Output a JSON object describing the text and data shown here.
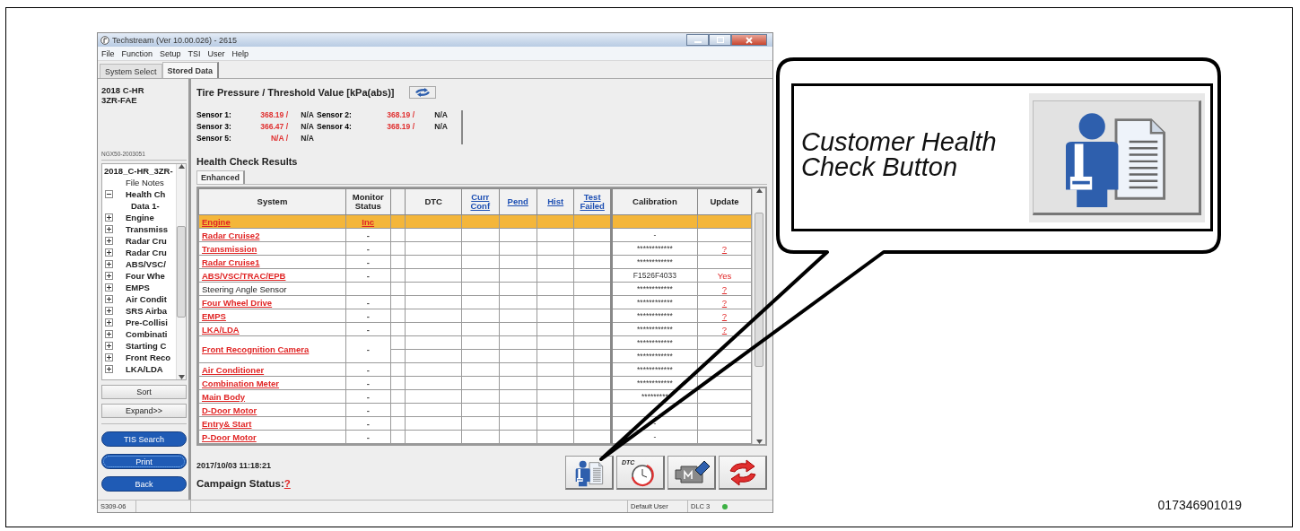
{
  "window": {
    "title": "Techstream (Ver 10.00.026) - 2615",
    "menu": [
      "File",
      "Function",
      "Setup",
      "TSI",
      "User",
      "Help"
    ],
    "tabs": [
      {
        "label": "System Select",
        "selected": false
      },
      {
        "label": "Stored Data",
        "selected": true
      }
    ],
    "vehicle": {
      "model": "2018 C-HR",
      "engine": "3ZR-FAE",
      "vin": "NGX50-2003051"
    },
    "tree": {
      "label": "2018_C-HR_3ZR-",
      "children": [
        {
          "label": "File Notes"
        },
        {
          "label": "Health Ch",
          "expanded": true,
          "children": [
            {
              "label": "Data 1-"
            }
          ]
        },
        {
          "label": "Engine",
          "expanded": false
        },
        {
          "label": "Transmiss",
          "expanded": false
        },
        {
          "label": "Radar Cru",
          "expanded": false
        },
        {
          "label": "Radar Cru",
          "expanded": false
        },
        {
          "label": "ABS/VSC/",
          "expanded": false
        },
        {
          "label": "Four Whe",
          "expanded": false
        },
        {
          "label": "EMPS",
          "expanded": false
        },
        {
          "label": "Air Condit",
          "expanded": false
        },
        {
          "label": "SRS Airba",
          "expanded": false
        },
        {
          "label": "Pre-Collisi",
          "expanded": false
        },
        {
          "label": "Combinati",
          "expanded": false
        },
        {
          "label": "Starting C",
          "expanded": false
        },
        {
          "label": "Front Reco",
          "expanded": false
        },
        {
          "label": "LKA/LDA",
          "expanded": false
        }
      ]
    },
    "left_buttons": [
      {
        "label": "Sort",
        "kind": "plain",
        "focused": false
      },
      {
        "label": "Expand>>",
        "kind": "plain",
        "focused": false
      },
      {
        "label": "TIS Search",
        "kind": "pill",
        "focused": false
      },
      {
        "label": "Print",
        "kind": "pill",
        "focused": true
      },
      {
        "label": "Back",
        "kind": "pill",
        "focused": false
      }
    ],
    "tire_pressure": {
      "title": "Tire Pressure / Threshold Value [kPa(abs)]",
      "sensors": [
        {
          "label": "Sensor 1:",
          "value": "368.19 /",
          "threshold": "N/A"
        },
        {
          "label": "Sensor 2:",
          "value": "368.19 /",
          "threshold": "N/A"
        },
        {
          "label": "Sensor 3:",
          "value": "366.47 /",
          "threshold": "N/A"
        },
        {
          "label": "Sensor 4:",
          "value": "368.19 /",
          "threshold": "N/A"
        },
        {
          "label": "Sensor 5:",
          "value": "N/A /",
          "threshold": "N/A"
        }
      ]
    },
    "health_check": {
      "title": "Health Check Results",
      "tabs": [
        {
          "label": "Enhanced",
          "selected": true
        }
      ],
      "columns": [
        {
          "label": "System",
          "kind": "plain"
        },
        {
          "label": "Monitor Status",
          "kind": "plain"
        },
        {
          "label": "DTC",
          "kind": "plain"
        },
        {
          "label": "Curr Conf",
          "kind": "link"
        },
        {
          "label": "Pend",
          "kind": "link"
        },
        {
          "label": "Hist",
          "kind": "link"
        },
        {
          "label": "Test Failed",
          "kind": "link"
        },
        {
          "label": "Calibration",
          "kind": "plain"
        },
        {
          "label": "Update",
          "kind": "plain"
        }
      ],
      "rows": [
        {
          "system": "Engine",
          "link": true,
          "monitor": "Inc",
          "monitor_link": true,
          "selected": true
        },
        {
          "system": "Radar Cruise2",
          "link": true,
          "monitor": "-",
          "monitor_link": false,
          "selected": false,
          "calibration": [
            "-"
          ]
        },
        {
          "system": "Transmission",
          "link": true,
          "monitor": "-",
          "monitor_link": false,
          "selected": false,
          "calibration": [
            "************"
          ],
          "update": "?",
          "update_link": true
        },
        {
          "system": "Radar Cruise1",
          "link": true,
          "monitor": "-",
          "selected": false,
          "calibration": [
            "************"
          ]
        },
        {
          "system": "ABS/VSC/TRAC/EPB",
          "link": true,
          "monitor": "-",
          "selected": false,
          "calibration": [
            "F1526F4033"
          ],
          "update": "Yes",
          "update_link": false
        },
        {
          "system": "Steering Angle Sensor",
          "link": false,
          "selected": false,
          "calibration": [
            "************"
          ],
          "update": "?",
          "update_link": true
        },
        {
          "system": "Four Wheel Drive",
          "link": true,
          "monitor": "-",
          "selected": false,
          "calibration": [
            "************"
          ],
          "update": "?",
          "update_link": true
        },
        {
          "system": "EMPS",
          "link": true,
          "monitor": "-",
          "selected": false,
          "calibration": [
            "************"
          ],
          "update": "?",
          "update_link": true
        },
        {
          "system": "LKA/LDA",
          "link": true,
          "monitor": "-",
          "selected": false,
          "calibration": [
            "************"
          ],
          "update": "?",
          "update_link": true
        },
        {
          "system": "Front Recognition Camera",
          "link": true,
          "monitor": "-",
          "selected": false,
          "calibration": [
            "************",
            "************"
          ]
        },
        {
          "system": "Air Conditioner",
          "link": true,
          "monitor": "-",
          "selected": false,
          "calibration": [
            "************"
          ]
        },
        {
          "system": "Combination Meter",
          "link": true,
          "monitor": "-",
          "selected": false,
          "calibration": [
            "************"
          ]
        },
        {
          "system": "Main Body",
          "link": true,
          "monitor": "-",
          "selected": false,
          "calibration": [
            "*********"
          ]
        },
        {
          "system": "D-Door Motor",
          "link": true,
          "monitor": "-",
          "selected": false
        },
        {
          "system": "Entry& Start",
          "link": true,
          "monitor": "-",
          "selected": false,
          "calibration": [
            "-"
          ]
        },
        {
          "system": "P-Door Motor",
          "link": true,
          "monitor": "-",
          "selected": false,
          "calibration": [
            "-"
          ]
        }
      ]
    },
    "timestamp": "2017/10/03 11:18:21",
    "campaign": {
      "label": "Campaign Status:",
      "value": "?"
    },
    "tool_buttons": [
      {
        "kind": "health-check"
      },
      {
        "kind": "dtc-timer",
        "label": "DTC"
      },
      {
        "kind": "engine-erase"
      },
      {
        "kind": "refresh"
      }
    ],
    "status_bar": {
      "code": "S309-06",
      "user": "Default User",
      "port": "DLC 3",
      "connected": true
    }
  },
  "callout": {
    "text": "Customer Health Check Button"
  },
  "figure_id": "017346901019"
}
